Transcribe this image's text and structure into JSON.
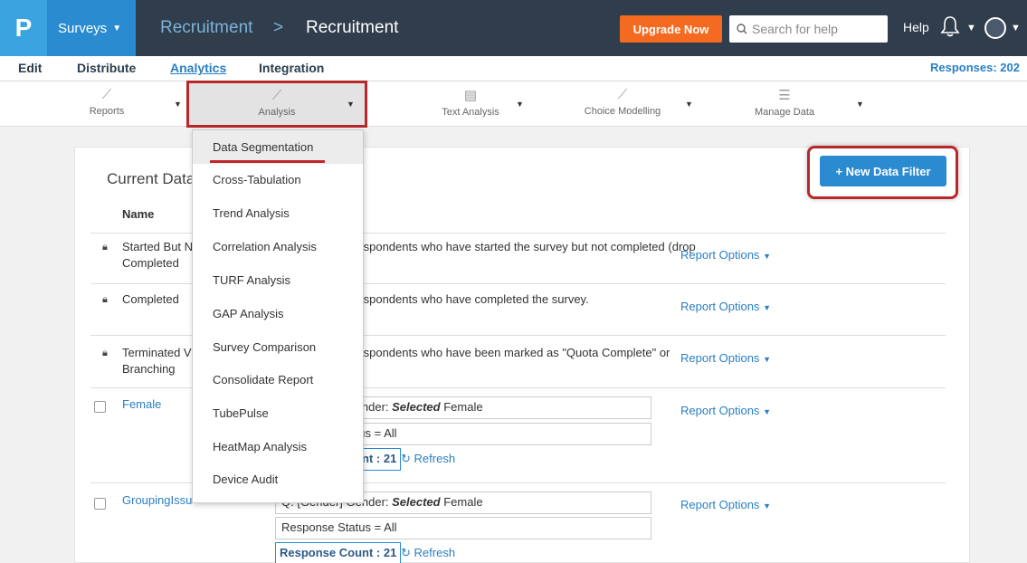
{
  "topbar": {
    "logo": "P",
    "surveys_label": "Surveys",
    "crumb_parent": "Recruitment",
    "crumb_sep": ">",
    "crumb_current": "Recruitment",
    "upgrade_label": "Upgrade Now",
    "search_placeholder": "Search for help",
    "help_label": "Help"
  },
  "menu": {
    "items": [
      "Edit",
      "Distribute",
      "Analytics",
      "Integration"
    ],
    "active": "Analytics",
    "responses": "Responses: 202"
  },
  "toolbar": {
    "tools": [
      {
        "label": "Reports",
        "icon": "line-chart-icon"
      },
      {
        "label": "Analysis",
        "icon": "analysis-chart-icon"
      },
      {
        "label": "Text Analysis",
        "icon": "document-icon"
      },
      {
        "label": "Choice Modelling",
        "icon": "choice-chart-icon"
      },
      {
        "label": "Manage Data",
        "icon": "database-icon"
      }
    ]
  },
  "panel": {
    "title": "Current Data Filters",
    "new_filter_label": "+ New Data Filter",
    "col_name": "Name",
    "report_options": "Report Options",
    "rows": [
      {
        "name1": "Started But N",
        "name2": "Completed",
        "desc": "Respondents who have started the survey but not completed (drop"
      },
      {
        "name1": "Completed",
        "name2": "",
        "desc": "Respondents who have completed the survey."
      },
      {
        "name1": "Terminated V",
        "name2": "Branching",
        "desc": "Respondents who have been marked as \"Quota Complete\" or"
      },
      {
        "name1": "Female",
        "crit1_prefix": "Q. [Gender] Gender: ",
        "crit1_bold": "Selected",
        "crit1_suffix": " Female",
        "crit2": "Response Status = All",
        "count": "Response Count : 21",
        "refresh": "Refresh"
      },
      {
        "name1": "GroupingIssu",
        "crit1_prefix": "Q. [Gender] Gender: ",
        "crit1_bold": "Selected",
        "crit1_suffix": " Female",
        "crit2": "Response Status = All",
        "count": "Response Count : 21",
        "refresh": "Refresh"
      }
    ]
  },
  "dropdown": {
    "items": [
      "Data Segmentation",
      "Cross-Tabulation",
      "Trend Analysis",
      "Correlation Analysis",
      "TURF Analysis",
      "GAP Analysis",
      "Survey Comparison",
      "Consolidate Report",
      "TubePulse",
      "HeatMap Analysis",
      "Device Audit"
    ]
  },
  "colors": {
    "topbar": "#2f3d4c",
    "accent": "#2a8bd1",
    "upgrade": "#f46a20",
    "highlight": "#b8272a"
  }
}
